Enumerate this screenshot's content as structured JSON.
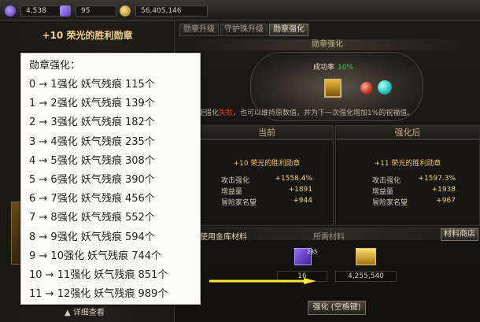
{
  "topbar": {
    "spirit": {
      "icon": "spirit-orb-icon",
      "value": "4,538"
    },
    "cube": {
      "icon": "cube-icon",
      "value": "95"
    },
    "gold": {
      "icon": "gold-coins-icon",
      "value": "56,405,146"
    }
  },
  "left": {
    "title": "+10 荣光的胜利勋章",
    "detail_link": "▲ 详细查看"
  },
  "tooltip": {
    "title": "勋章强化：",
    "rows": [
      "0 → 1强化  妖气残痕 115个",
      "1 → 2强化  妖气残痕 139个",
      "2 → 3强化  妖气残痕 182个",
      "3 → 4强化  妖气残痕 235个",
      "4 → 5强化  妖气残痕 308个",
      "5 → 6强化  妖气残痕 390个",
      "6 → 7强化  妖气残痕 456个",
      "7 → 8强化  妖气残痕 552个",
      "8 → 9强化  妖气残痕 594个",
      "9 → 10强化   妖气残痕 744个",
      "10 → 11强化  妖气残痕 851个",
      "11 → 12强化  妖气残痕 989个"
    ]
  },
  "tabs": [
    "勋章升级",
    "守护珠升级",
    "勋章强化"
  ],
  "active_tab": 2,
  "enhance": {
    "section_title": "勋章强化",
    "success_rate_label": "成功率",
    "success_rate_value": "10%",
    "warning_pre": "即使强化",
    "warning_fail": "失败",
    "warning_post": "，也可以维持原数值，并为下一次强化增加1%的祝福值。"
  },
  "compare": {
    "before_header": "当前",
    "after_header": "强化后",
    "before": {
      "name": "+10 荣光的胜利勋章",
      "stats": [
        {
          "k": "攻击强化",
          "v": "+1558.4%"
        },
        {
          "k": "增益量",
          "v": "+1891"
        },
        {
          "k": "冒险家名望",
          "v": "+944"
        }
      ]
    },
    "after": {
      "name": "+11 荣光的胜利勋章",
      "stats": [
        {
          "k": "攻击强化",
          "v": "+1597.3%"
        },
        {
          "k": "增益量",
          "v": "+1938"
        },
        {
          "k": "冒险家名望",
          "v": "+967"
        }
      ]
    }
  },
  "materials": {
    "use_vault": "使用金库材料",
    "header": "所需材料",
    "shop_button": "材料商店",
    "item1_badge": "235",
    "item1_count": "16",
    "item2_count": "4,255,540"
  },
  "strengthen_button": "强化 (空格键)",
  "colors": {
    "success_green": "#3fd24a",
    "fail_red": "#e23c2c",
    "gold_text": "#f0c35a",
    "arrow_yellow": "#ffe93a"
  }
}
